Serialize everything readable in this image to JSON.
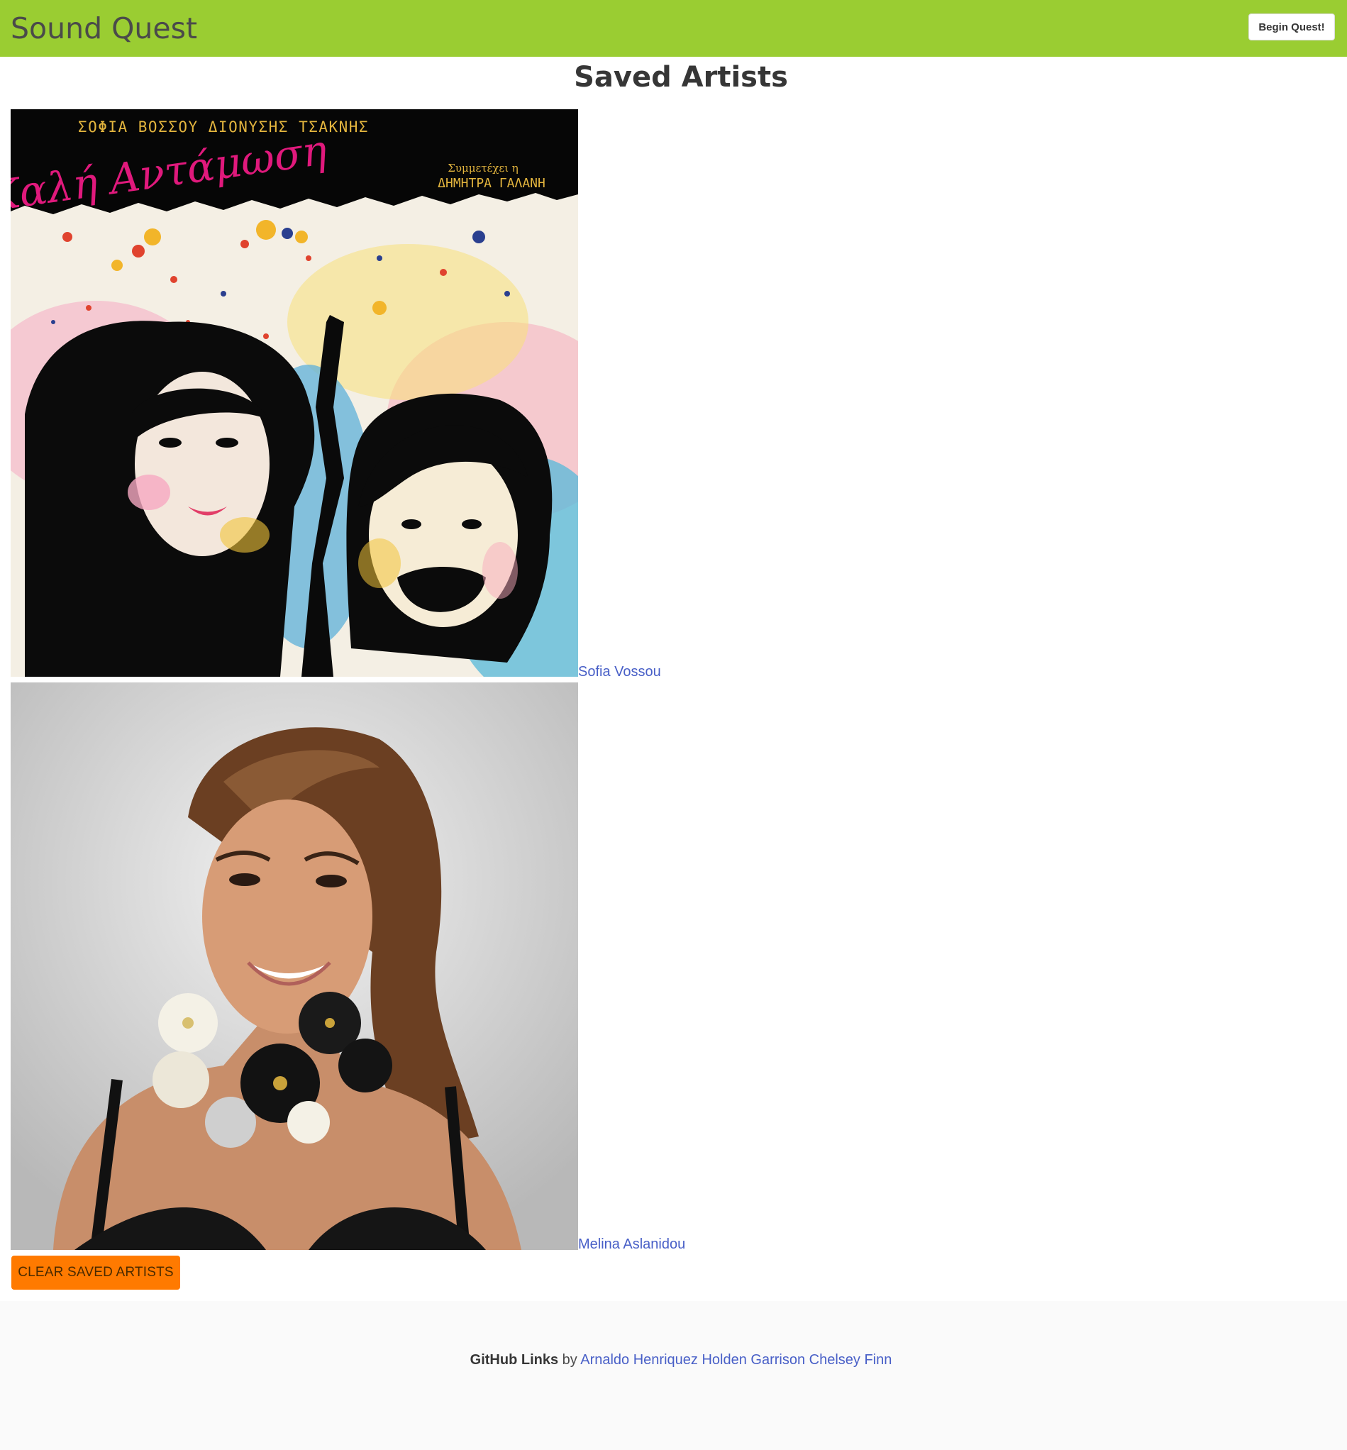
{
  "navbar": {
    "brand": "Sound Quest",
    "begin_button": "Begin Quest!"
  },
  "page": {
    "title": "Saved Artists"
  },
  "artists": [
    {
      "name": "Sofia Vossou",
      "image_text": {
        "top": "ΣΟΦΙΑ ΒΟΣΣΟΥ ΔΙΟΝΥΣΗΣ ΤΣΑΚΝΗΣ",
        "script_title": "Καλή Αντάμωση",
        "featuring_line": "Συμμετέχει η",
        "featuring_name": "ΔΗΜΗΤΡΑ ΓΑΛΑΝΗ"
      }
    },
    {
      "name": "Melina Aslanidou"
    }
  ],
  "clear_button": "CLEAR SAVED ARTISTS",
  "footer": {
    "label": "GitHub Links",
    "by": "by",
    "authors": [
      "Arnaldo Henriquez",
      "Holden Garrison",
      "Chelsey Finn"
    ]
  },
  "colors": {
    "navbar": "#9acd32",
    "clear_button": "#ff7a00",
    "link": "#485fc7",
    "footer_bg": "#fafafa"
  }
}
